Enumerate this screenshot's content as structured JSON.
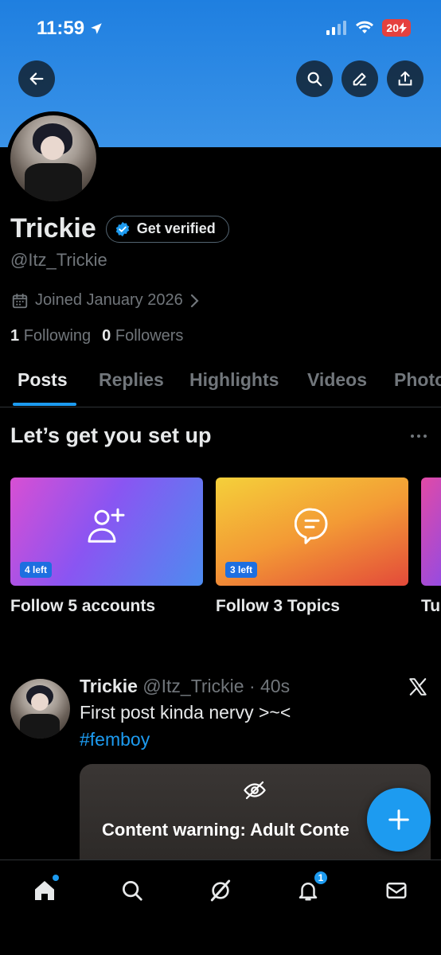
{
  "status_bar": {
    "time": "11:59",
    "battery": "20"
  },
  "profile": {
    "name": "Trickie",
    "verify_label": "Get verified",
    "handle": "@Itz_Trickie",
    "joined": "Joined January 2026",
    "following_count": "1",
    "following_label": "Following",
    "followers_count": "0",
    "followers_label": "Followers"
  },
  "tabs": [
    {
      "label": "Posts",
      "active": true
    },
    {
      "label": "Replies"
    },
    {
      "label": "Highlights"
    },
    {
      "label": "Videos"
    },
    {
      "label": "Photo"
    }
  ],
  "setup": {
    "title": "Let’s get you set up",
    "cards": [
      {
        "badge": "4 left",
        "label": "Follow 5 accounts",
        "icon": "add-user-icon"
      },
      {
        "badge": "3 left",
        "label": "Follow 3 Topics",
        "icon": "topic-icon"
      },
      {
        "label": "Tu"
      }
    ]
  },
  "post": {
    "name": "Trickie",
    "meta": "@Itz_Trickie · 40s",
    "text": "First post kinda nervy >~<",
    "hashtag": "#femboy",
    "warning": "Content warning: Adult Conte"
  },
  "bottom_nav": {
    "items": [
      "home-icon",
      "search-icon",
      "grok-icon",
      "bell-icon",
      "mail-icon"
    ],
    "notif_count": "1"
  },
  "colors": {
    "accent": "#1d9bf0",
    "banner": "#2f8ae6",
    "muted": "#71767b"
  }
}
